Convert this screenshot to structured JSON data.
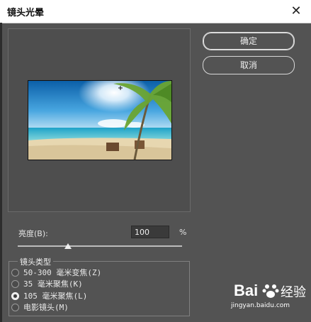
{
  "window": {
    "title": "镜头光晕",
    "close_glyph": "✕"
  },
  "buttons": {
    "ok": "确定",
    "cancel": "取消"
  },
  "brightness": {
    "label": "亮度(B):",
    "value": "100",
    "unit": "%",
    "slider_level_percent": 30
  },
  "lens_type": {
    "title": "镜头类型",
    "options": [
      {
        "label": "50-300 毫米变焦(Z)",
        "checked": false
      },
      {
        "label": "35 毫米聚焦(K)",
        "checked": false
      },
      {
        "label": "105 毫米聚焦(L)",
        "checked": true
      },
      {
        "label": "电影镜头(M)",
        "checked": false
      }
    ]
  },
  "watermark": {
    "brand": "Bai",
    "brand_cn": "经验",
    "url": "jingyan.baidu.com"
  }
}
